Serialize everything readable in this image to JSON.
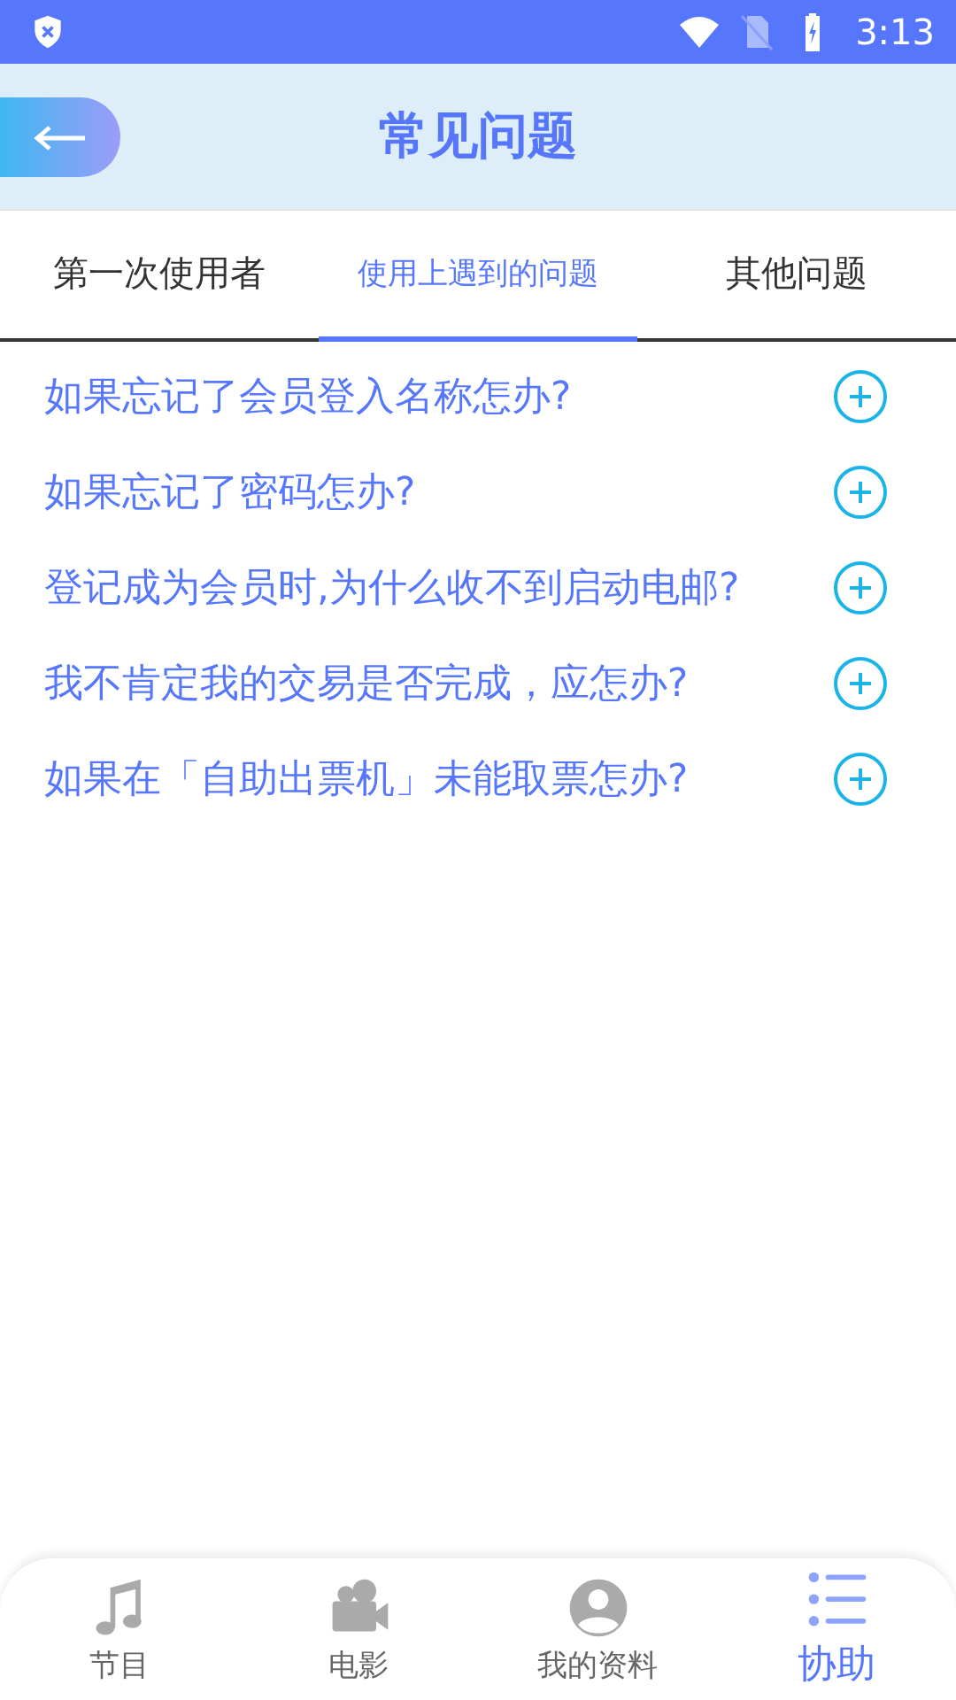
{
  "status_bar": {
    "time": "3:13"
  },
  "header": {
    "title": "常见问题"
  },
  "tabs": [
    {
      "label": "第一次使用者",
      "selected": false
    },
    {
      "label": "使用上遇到的问题",
      "selected": true
    },
    {
      "label": "其他问题",
      "selected": false
    }
  ],
  "questions": [
    {
      "text": "如果忘记了会员登入名称怎办?",
      "expanded": false
    },
    {
      "text": "如果忘记了密码怎办?",
      "expanded": false
    },
    {
      "text": "登记成为会员时,为什么收不到启动电邮?",
      "expanded": false
    },
    {
      "text": "我不肯定我的交易是否完成，应怎办?",
      "expanded": false
    },
    {
      "text": "如果在「自助出票机」未能取票怎办?",
      "expanded": false
    }
  ],
  "bottom_nav": [
    {
      "label": "节目",
      "kind": "music",
      "selected": false
    },
    {
      "label": "电影",
      "kind": "camera",
      "selected": false
    },
    {
      "label": "我的资料",
      "kind": "profile",
      "selected": false
    },
    {
      "label": "协助",
      "kind": "list",
      "selected": true
    }
  ]
}
